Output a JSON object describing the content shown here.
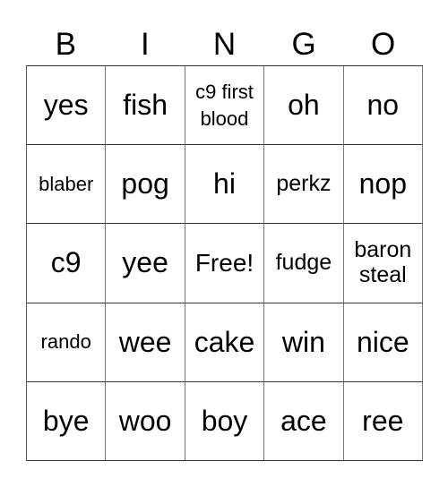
{
  "header": [
    "B",
    "I",
    "N",
    "G",
    "O"
  ],
  "cells": [
    [
      "yes",
      "fish",
      "c9 first blood",
      "oh",
      "no"
    ],
    [
      "blaber",
      "pog",
      "hi",
      "perkz",
      "nop"
    ],
    [
      "c9",
      "yee",
      "Free!",
      "fudge",
      "baron steal"
    ],
    [
      "rando",
      "wee",
      "cake",
      "win",
      "nice"
    ],
    [
      "bye",
      "woo",
      "boy",
      "ace",
      "ree"
    ]
  ]
}
